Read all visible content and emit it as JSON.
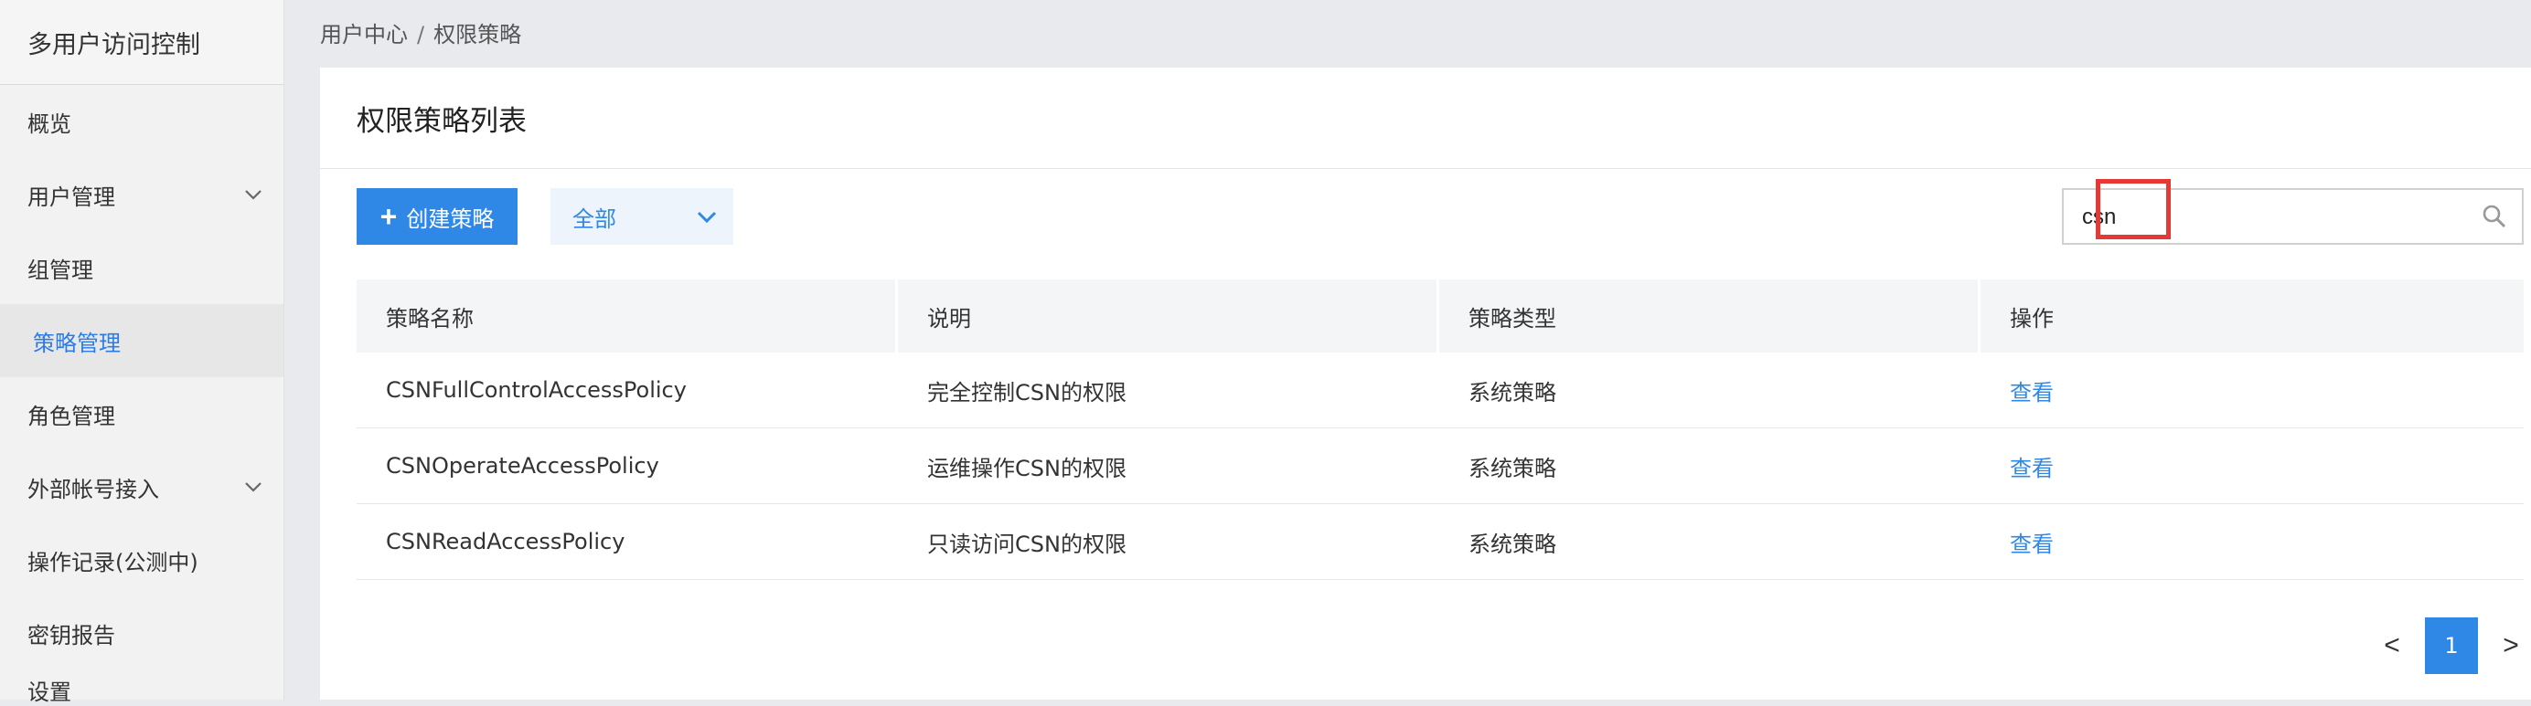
{
  "sidebar": {
    "title": "多用户访问控制",
    "items": [
      {
        "label": "概览"
      },
      {
        "label": "用户管理"
      },
      {
        "label": "组管理"
      },
      {
        "label": "策略管理"
      },
      {
        "label": "角色管理"
      },
      {
        "label": "外部帐号接入"
      },
      {
        "label": "操作记录(公测中)"
      },
      {
        "label": "密钥报告"
      },
      {
        "label": "设置"
      }
    ],
    "active_index": 3
  },
  "breadcrumb": {
    "root": "用户中心",
    "separator": "/",
    "current": "权限策略"
  },
  "main": {
    "title": "权限策略列表",
    "create_button": "创建策略",
    "filter_value": "全部",
    "search_value": "csn",
    "columns": [
      "策略名称",
      "说明",
      "策略类型",
      "操作"
    ],
    "rows": [
      {
        "name": "CSNFullControlAccessPolicy",
        "desc": "完全控制CSN的权限",
        "type": "系统策略",
        "action": "查看"
      },
      {
        "name": "CSNOperateAccessPolicy",
        "desc": "运维操作CSN的权限",
        "type": "系统策略",
        "action": "查看"
      },
      {
        "name": "CSNReadAccessPolicy",
        "desc": "只读访问CSN的权限",
        "type": "系统策略",
        "action": "查看"
      }
    ]
  },
  "pagination": {
    "prev": "<",
    "current_page": "1",
    "next": ">"
  },
  "colors": {
    "accent": "#2f88e6",
    "highlight": "#e53935"
  }
}
